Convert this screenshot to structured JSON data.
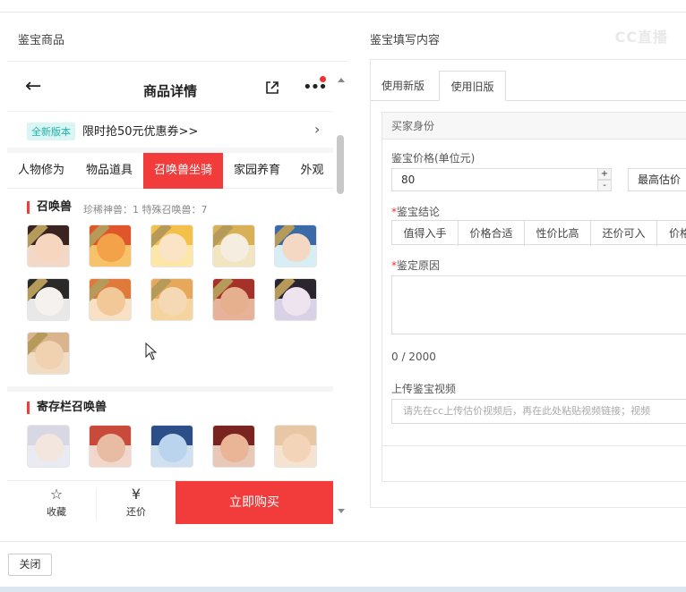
{
  "left_panel_title": "鉴宝商品",
  "right_panel_title": "鉴宝填写内容",
  "watermark": "CC直播",
  "phone": {
    "nav_title": "商品详情",
    "promo_tag": "全新版本",
    "promo_text": "限时抢50元优惠券>>",
    "tabs": [
      "人物修为",
      "物品道具",
      "召唤兽坐骑",
      "家园养育",
      "外观"
    ],
    "section1": {
      "title": "召唤兽",
      "subtitle": "珍稀神兽：1   特殊召唤兽：7"
    },
    "section2": {
      "title": "寄存栏召唤兽"
    },
    "bottom": {
      "favorite": "收藏",
      "bargain": "还价",
      "buy": "立即购买"
    }
  },
  "form": {
    "tabs": [
      "使用新版",
      "使用旧版"
    ],
    "section_head": "买家身份",
    "price_label": "鉴宝价格(单位元)",
    "price_value": "80",
    "price_extra": "最高估价",
    "conclusion_label": "鉴宝结论",
    "conclusion_options": [
      "值得入手",
      "价格合适",
      "性价比高",
      "还价可入",
      "价格"
    ],
    "reason_label": "鉴定原因",
    "reason_counter": "0 / 2000",
    "video_label": "上传鉴宝视频",
    "video_placeholder": "请先在cc上传估价视频后，再在此处粘贴视频链接；视频"
  },
  "footer": {
    "close": "关闭"
  },
  "colors": {
    "accent": "#f23c3c",
    "tag_bg": "#d9f6f4",
    "tag_text": "#22b2a8"
  }
}
